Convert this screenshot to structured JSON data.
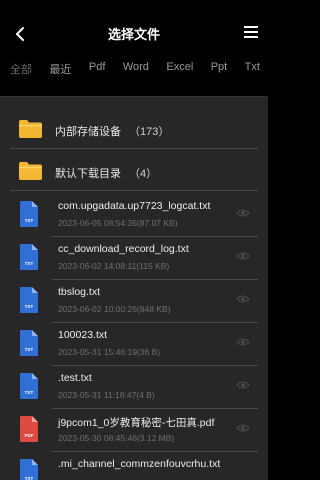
{
  "header": {
    "title": "选择文件",
    "back_icon": "back-arrow-icon",
    "menu_icon": "hamburger-menu-icon"
  },
  "tabs": [
    {
      "label": "全部",
      "active": true
    },
    {
      "label": "最近"
    },
    {
      "label": "Pdf"
    },
    {
      "label": "Word"
    },
    {
      "label": "Excel"
    },
    {
      "label": "Ppt"
    },
    {
      "label": "Txt"
    }
  ],
  "folders": [
    {
      "name": "内部存储设备",
      "count": "（173）"
    },
    {
      "name": "默认下载目录",
      "count": "（4）"
    }
  ],
  "files": [
    {
      "name": "com.upgadata.up7723_logcat.txt",
      "meta": "2023-06-05 08:54:35(87.07 KB)",
      "type": "TXT"
    },
    {
      "name": "cc_download_record_log.txt",
      "meta": "2023-06-02 14:08:11(115 KB)",
      "type": "TXT"
    },
    {
      "name": "tbslog.txt",
      "meta": "2023-06-02 10:00:26(848 KB)",
      "type": "TXT"
    },
    {
      "name": "100023.txt",
      "meta": "2023-05-31 15:46:19(36 B)",
      "type": "TXT"
    },
    {
      "name": ".test.txt",
      "meta": "2023-05-31 11:18:47(4 B)",
      "type": "TXT"
    },
    {
      "name": "j9pcom1_0岁教育秘密-七田真.pdf",
      "meta": "2023-05-30 08:45:46(3.12 MB)",
      "type": "PDF"
    },
    {
      "name": ".mi_channel_commzenfouvcrhu.txt",
      "meta": "",
      "type": "TXT"
    }
  ],
  "colors": {
    "background": "#000000",
    "list_bg": "#272727",
    "folder": "#f5b731",
    "txt_icon": "#2f6fd6",
    "pdf_icon": "#e04a3f"
  }
}
